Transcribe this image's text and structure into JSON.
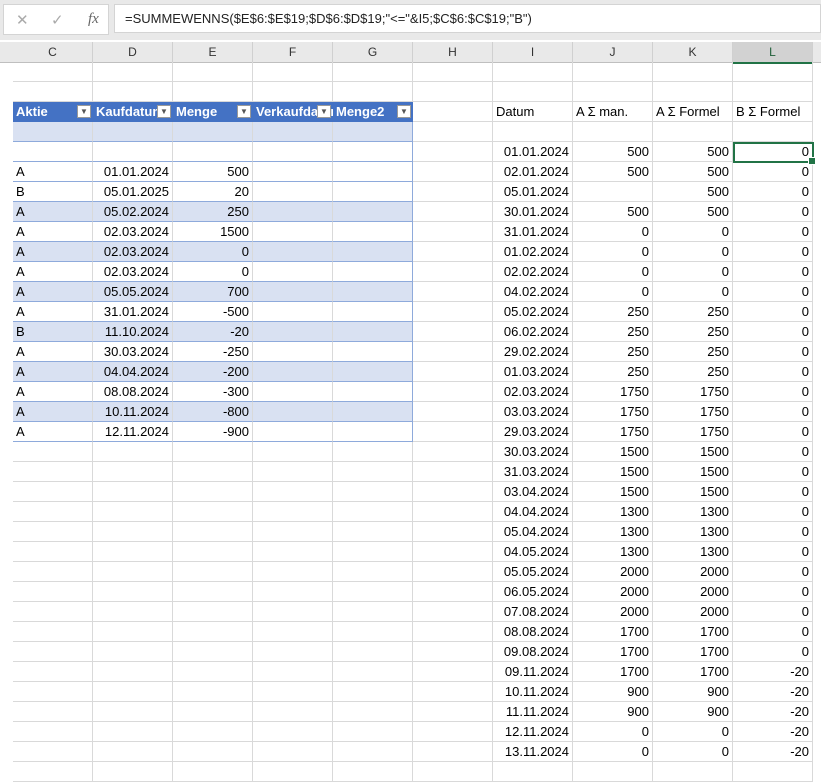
{
  "formula_bar": {
    "cancel_icon": "✕",
    "confirm_icon": "✓",
    "fx_label": "fx",
    "formula": "=SUMMEWENNS($E$6:$E$19;$D$6:$D$19;\"<=\"&I5;$C$6:$C$19;\"B\")"
  },
  "columns": [
    "C",
    "D",
    "E",
    "F",
    "G",
    "H",
    "I",
    "J",
    "K",
    "L"
  ],
  "selected_column": "L",
  "table": {
    "headers": [
      "Aktie",
      "Kaufdatum",
      "Menge",
      "Verkaufdatum",
      "Menge2"
    ],
    "rows": [
      [
        "A",
        "01.01.2024",
        "500"
      ],
      [
        "B",
        "05.01.2025",
        "20"
      ],
      [
        "A",
        "05.02.2024",
        "250"
      ],
      [
        "A",
        "02.03.2024",
        "1500"
      ],
      [
        "A",
        "02.03.2024",
        "0"
      ],
      [
        "A",
        "02.03.2024",
        "0"
      ],
      [
        "A",
        "05.05.2024",
        "700"
      ],
      [
        "A",
        "31.01.2024",
        "-500"
      ],
      [
        "B",
        "11.10.2024",
        "-20"
      ],
      [
        "A",
        "30.03.2024",
        "-250"
      ],
      [
        "A",
        "04.04.2024",
        "-200"
      ],
      [
        "A",
        "08.08.2024",
        "-300"
      ],
      [
        "A",
        "10.11.2024",
        "-800"
      ],
      [
        "A",
        "12.11.2024",
        "-900"
      ]
    ]
  },
  "summary": {
    "headers": [
      "Datum",
      "A Σ man.",
      "A Σ Formel",
      "B Σ Formel"
    ],
    "rows": [
      [
        "01.01.2024",
        "500",
        "500",
        "0"
      ],
      [
        "02.01.2024",
        "500",
        "500",
        "0"
      ],
      [
        "05.01.2024",
        "",
        "500",
        "0"
      ],
      [
        "30.01.2024",
        "500",
        "500",
        "0"
      ],
      [
        "31.01.2024",
        "0",
        "0",
        "0"
      ],
      [
        "01.02.2024",
        "0",
        "0",
        "0"
      ],
      [
        "02.02.2024",
        "0",
        "0",
        "0"
      ],
      [
        "04.02.2024",
        "0",
        "0",
        "0"
      ],
      [
        "05.02.2024",
        "250",
        "250",
        "0"
      ],
      [
        "06.02.2024",
        "250",
        "250",
        "0"
      ],
      [
        "29.02.2024",
        "250",
        "250",
        "0"
      ],
      [
        "01.03.2024",
        "250",
        "250",
        "0"
      ],
      [
        "02.03.2024",
        "1750",
        "1750",
        "0"
      ],
      [
        "03.03.2024",
        "1750",
        "1750",
        "0"
      ],
      [
        "29.03.2024",
        "1750",
        "1750",
        "0"
      ],
      [
        "30.03.2024",
        "1500",
        "1500",
        "0"
      ],
      [
        "31.03.2024",
        "1500",
        "1500",
        "0"
      ],
      [
        "03.04.2024",
        "1500",
        "1500",
        "0"
      ],
      [
        "04.04.2024",
        "1300",
        "1300",
        "0"
      ],
      [
        "05.04.2024",
        "1300",
        "1300",
        "0"
      ],
      [
        "04.05.2024",
        "1300",
        "1300",
        "0"
      ],
      [
        "05.05.2024",
        "2000",
        "2000",
        "0"
      ],
      [
        "06.05.2024",
        "2000",
        "2000",
        "0"
      ],
      [
        "07.08.2024",
        "2000",
        "2000",
        "0"
      ],
      [
        "08.08.2024",
        "1700",
        "1700",
        "0"
      ],
      [
        "09.08.2024",
        "1700",
        "1700",
        "0"
      ],
      [
        "09.11.2024",
        "1700",
        "1700",
        "-20"
      ],
      [
        "10.11.2024",
        "900",
        "900",
        "-20"
      ],
      [
        "11.11.2024",
        "900",
        "900",
        "-20"
      ],
      [
        "12.11.2024",
        "0",
        "0",
        "-20"
      ],
      [
        "13.11.2024",
        "0",
        "0",
        "-20"
      ]
    ]
  },
  "colors": {
    "table_header": "#4472c4",
    "table_band": "#d9e1f2",
    "selection": "#217346"
  }
}
